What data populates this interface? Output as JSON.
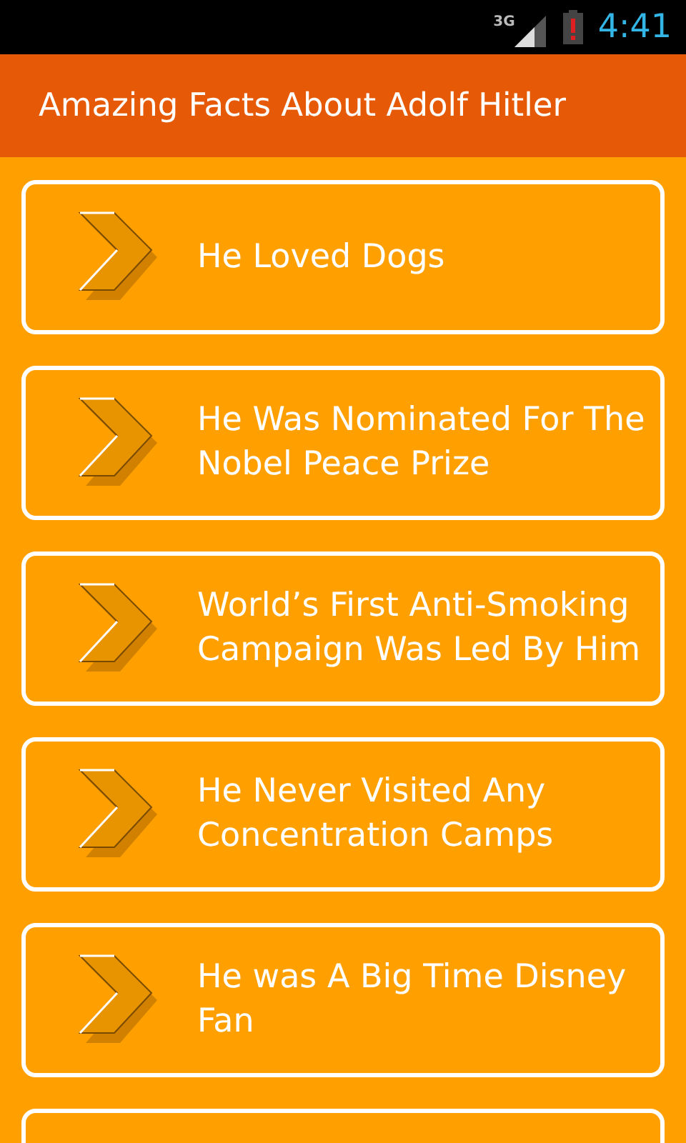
{
  "status_bar": {
    "network": "3G",
    "time": "4:41"
  },
  "action_bar": {
    "title": "Amazing Facts About Adolf Hitler"
  },
  "items": [
    {
      "kind": "fact",
      "title": "He Loved Dogs"
    },
    {
      "kind": "fact",
      "title": "He Was Nominated For The Nobel Peace Prize"
    },
    {
      "kind": "fact",
      "title": "World’s First Anti-Smoking Campaign Was Led By Him"
    },
    {
      "kind": "fact",
      "title": "He Never Visited Any Concentration Camps"
    },
    {
      "kind": "fact",
      "title": "He was A Big Time Disney Fan"
    },
    {
      "kind": "cut"
    }
  ]
}
